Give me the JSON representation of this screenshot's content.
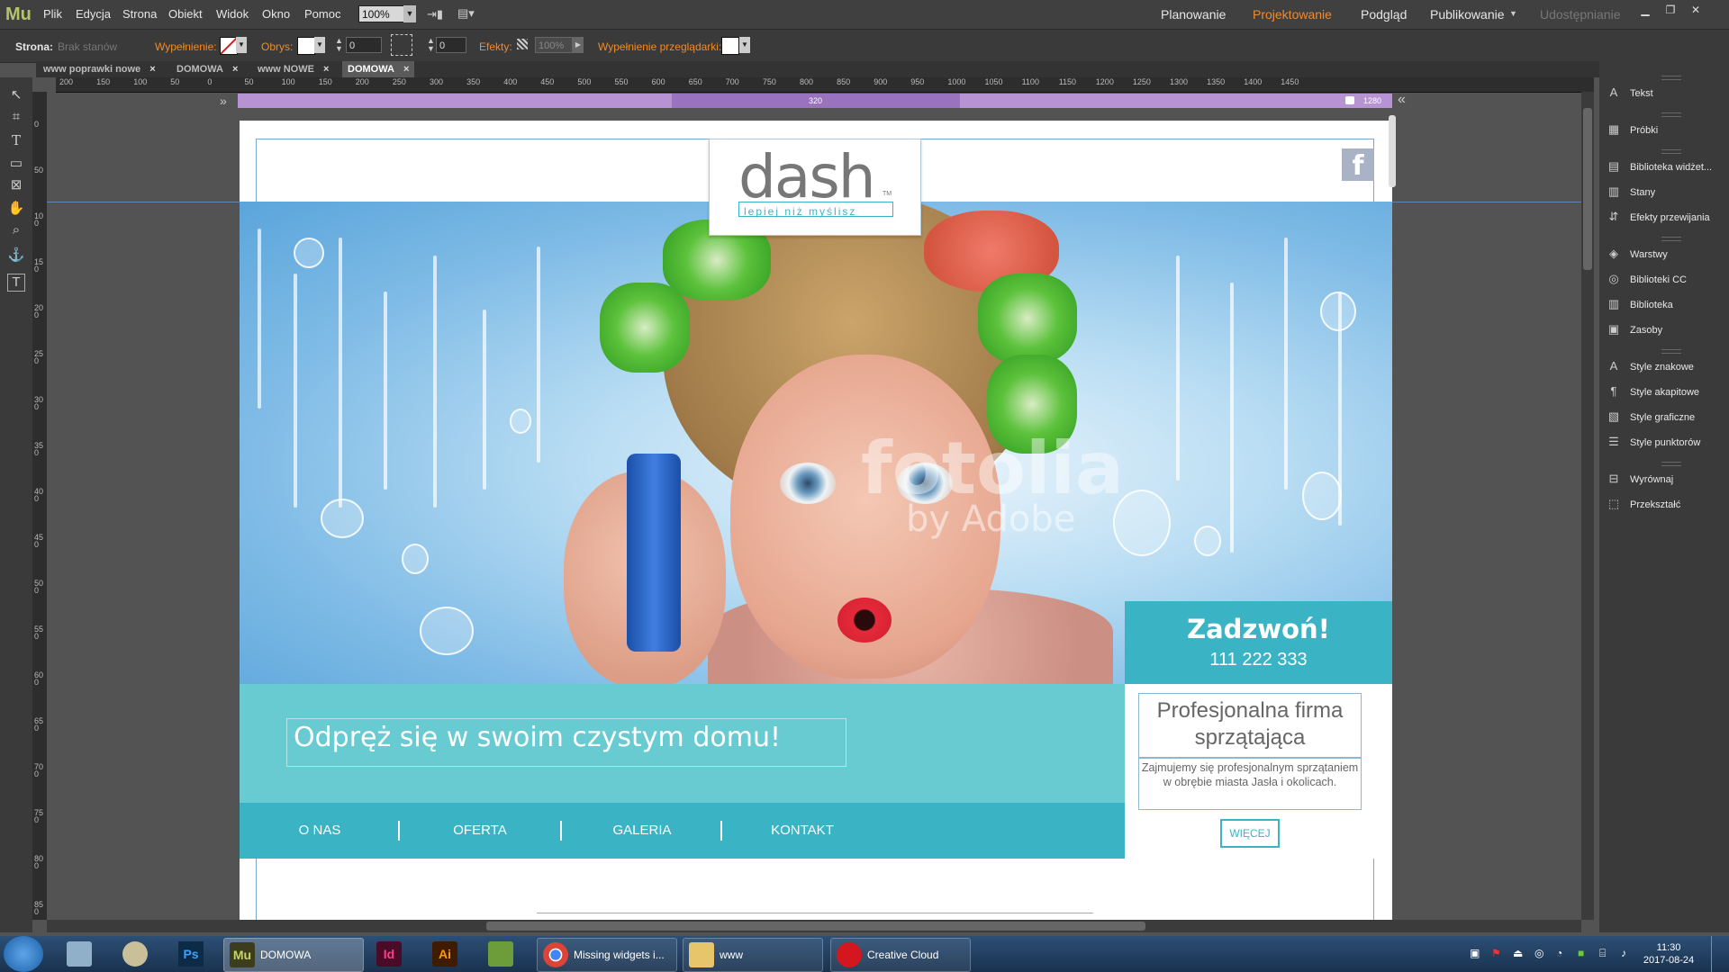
{
  "menubar": {
    "logo": "Mu",
    "menus": [
      "Plik",
      "Edycja",
      "Strona",
      "Obiekt",
      "Widok",
      "Okno",
      "Pomoc"
    ],
    "zoom": "100%",
    "modes": [
      "Planowanie",
      "Projektowanie",
      "Podgląd",
      "Publikowanie",
      "Udostępnianie"
    ],
    "active_mode": "Projektowanie"
  },
  "controlbar": {
    "strona_label": "Strona:",
    "strona_value": "Brak stanów",
    "wypelnienie_label": "Wypełnienie:",
    "obrys_label": "Obrys:",
    "obrys_value": "0",
    "corner_value": "0",
    "efekty_label": "Efekty:",
    "efekty_value": "100%",
    "browser_fill_label": "Wypełnienie przeglądarki:"
  },
  "tabs": [
    {
      "label": "www poprawki nowe"
    },
    {
      "label": "DOMOWA"
    },
    {
      "label": "www NOWE"
    },
    {
      "label": "DOMOWA",
      "active": true
    }
  ],
  "ruler": {
    "h_ticks": [
      "200",
      "150",
      "100",
      "50",
      "0",
      "50",
      "100",
      "150",
      "200",
      "250",
      "300",
      "350",
      "400",
      "450",
      "500",
      "550",
      "600",
      "650",
      "700",
      "750",
      "800",
      "850",
      "900",
      "950",
      "1000",
      "1050",
      "1100",
      "1150",
      "1200",
      "1250",
      "1300",
      "1350",
      "1400",
      "1450"
    ],
    "v_ticks": [
      "0",
      "50",
      "100",
      "150",
      "200",
      "250",
      "300",
      "350",
      "400",
      "450",
      "500",
      "550",
      "600",
      "650",
      "700",
      "750",
      "800",
      "850"
    ]
  },
  "breakpoints": {
    "label_320": "320",
    "label_1280": "1280"
  },
  "page": {
    "logo_word": "dash",
    "logo_tagline": "lepiej niż myślisz",
    "logo_tm": "TM",
    "facebook": "f",
    "watermark1": "fotolia",
    "watermark2": "by Adobe",
    "tagline": "Odpręż się w swoim czystym domu!",
    "nav": [
      "O NAS",
      "OFERTA",
      "GALERIA",
      "KONTAKT"
    ],
    "call_title": "Zadzwoń!",
    "call_phone": "111 222 333",
    "info_title": "Profesjonalna firma sprzątająca",
    "info_text": "Zajmujemy się profesjonalnym sprzątaniem w obrębie  miasta Jasła i okolicach.",
    "more_button": "WIĘCEJ"
  },
  "panels": {
    "items": [
      {
        "icon": "text-icon",
        "label": "Tekst"
      },
      {
        "icon": "swatches-icon",
        "label": "Próbki"
      },
      {
        "icon": "widgets-icon",
        "label": "Biblioteka widżet..."
      },
      {
        "icon": "states-icon",
        "label": "Stany"
      },
      {
        "icon": "transitions-icon",
        "label": "Efekty przewijania"
      },
      {
        "icon": "layers-icon",
        "label": "Warstwy"
      },
      {
        "icon": "cc-libraries-icon",
        "label": "Biblioteki CC"
      },
      {
        "icon": "library-icon",
        "label": "Biblioteka"
      },
      {
        "icon": "assets-icon",
        "label": "Zasoby"
      },
      {
        "icon": "char-styles-icon",
        "label": "Style znakowe"
      },
      {
        "icon": "para-styles-icon",
        "label": "Style akapitowe"
      },
      {
        "icon": "graphic-styles-icon",
        "label": "Style graficzne"
      },
      {
        "icon": "bullet-styles-icon",
        "label": "Style punktorów"
      },
      {
        "icon": "align-icon",
        "label": "Wyrównaj"
      },
      {
        "icon": "transform-icon",
        "label": "Przekształć"
      }
    ]
  },
  "taskbar": {
    "items": [
      {
        "icon": "muse-icon",
        "label": "DOMOWA"
      },
      {
        "icon": "indesign-icon",
        "label": ""
      },
      {
        "icon": "illustrator-icon",
        "label": ""
      },
      {
        "icon": "chrome-icon",
        "label": "Missing widgets i..."
      },
      {
        "icon": "folder-icon",
        "label": "www"
      },
      {
        "icon": "creative-cloud-icon",
        "label": "Creative Cloud"
      }
    ],
    "time": "11:30",
    "date": "2017-08-24"
  }
}
